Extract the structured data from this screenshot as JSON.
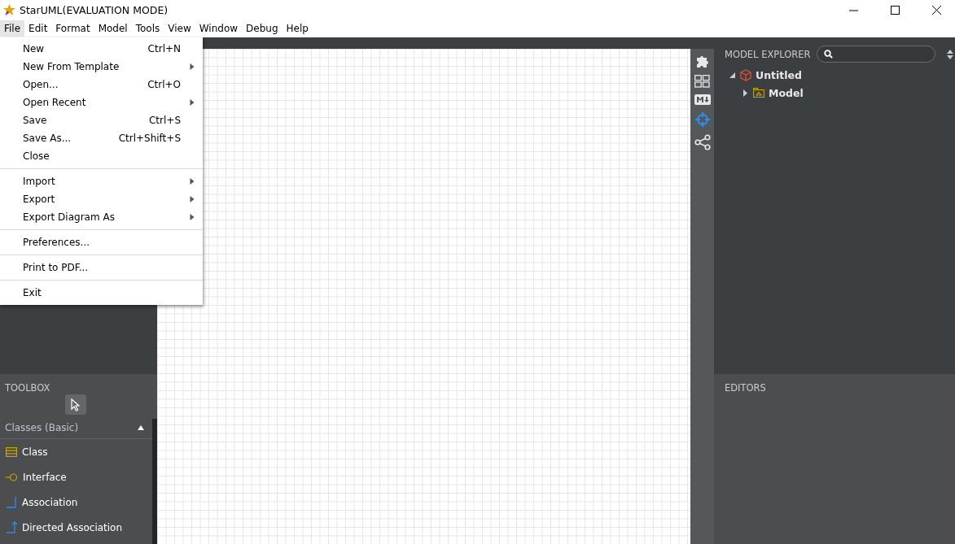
{
  "window": {
    "title": "StarUML(EVALUATION MODE)"
  },
  "menubar": [
    {
      "label": "File",
      "selected": true
    },
    {
      "label": "Edit",
      "selected": false
    },
    {
      "label": "Format",
      "selected": false
    },
    {
      "label": "Model",
      "selected": false
    },
    {
      "label": "Tools",
      "selected": false
    },
    {
      "label": "View",
      "selected": false
    },
    {
      "label": "Window",
      "selected": false
    },
    {
      "label": "Debug",
      "selected": false
    },
    {
      "label": "Help",
      "selected": false
    }
  ],
  "file_menu": [
    [
      {
        "label": "New",
        "shortcut": "Ctrl+N",
        "submenu": false
      },
      {
        "label": "New From Template",
        "submenu": true
      },
      {
        "label": "Open...",
        "shortcut": "Ctrl+O",
        "submenu": false
      },
      {
        "label": "Open Recent",
        "submenu": true
      },
      {
        "label": "Save",
        "shortcut": "Ctrl+S",
        "submenu": false
      },
      {
        "label": "Save As...",
        "shortcut": "Ctrl+Shift+S",
        "submenu": false
      },
      {
        "label": "Close",
        "submenu": false
      }
    ],
    [
      {
        "label": "Import",
        "submenu": true
      },
      {
        "label": "Export",
        "submenu": true
      },
      {
        "label": "Export Diagram As",
        "submenu": true
      }
    ],
    [
      {
        "label": "Preferences...",
        "submenu": false
      }
    ],
    [
      {
        "label": "Print to PDF...",
        "submenu": false
      }
    ],
    [
      {
        "label": "Exit",
        "submenu": false
      }
    ]
  ],
  "toolbox": {
    "title": "TOOLBOX",
    "group": {
      "label": "Classes (Basic)",
      "expanded": true
    },
    "items": [
      {
        "kind": "class",
        "label": "Class"
      },
      {
        "kind": "interface",
        "label": "Interface"
      },
      {
        "kind": "association",
        "label": "Association"
      },
      {
        "kind": "directed-association",
        "label": "Directed Association"
      }
    ]
  },
  "side_icons": [
    {
      "kind": "puzzle",
      "selected": false
    },
    {
      "kind": "layout",
      "selected": false
    },
    {
      "kind": "markdown",
      "selected": false
    },
    {
      "kind": "crosshair",
      "selected": true
    },
    {
      "kind": "share",
      "selected": false
    }
  ],
  "model_explorer": {
    "title": "MODEL EXPLORER",
    "tree": [
      {
        "kind": "project",
        "label": "Untitled",
        "expanded": true,
        "children": [
          {
            "kind": "model",
            "label": "Model",
            "expanded": false
          }
        ]
      }
    ]
  },
  "editors": {
    "title": "EDITORS"
  }
}
